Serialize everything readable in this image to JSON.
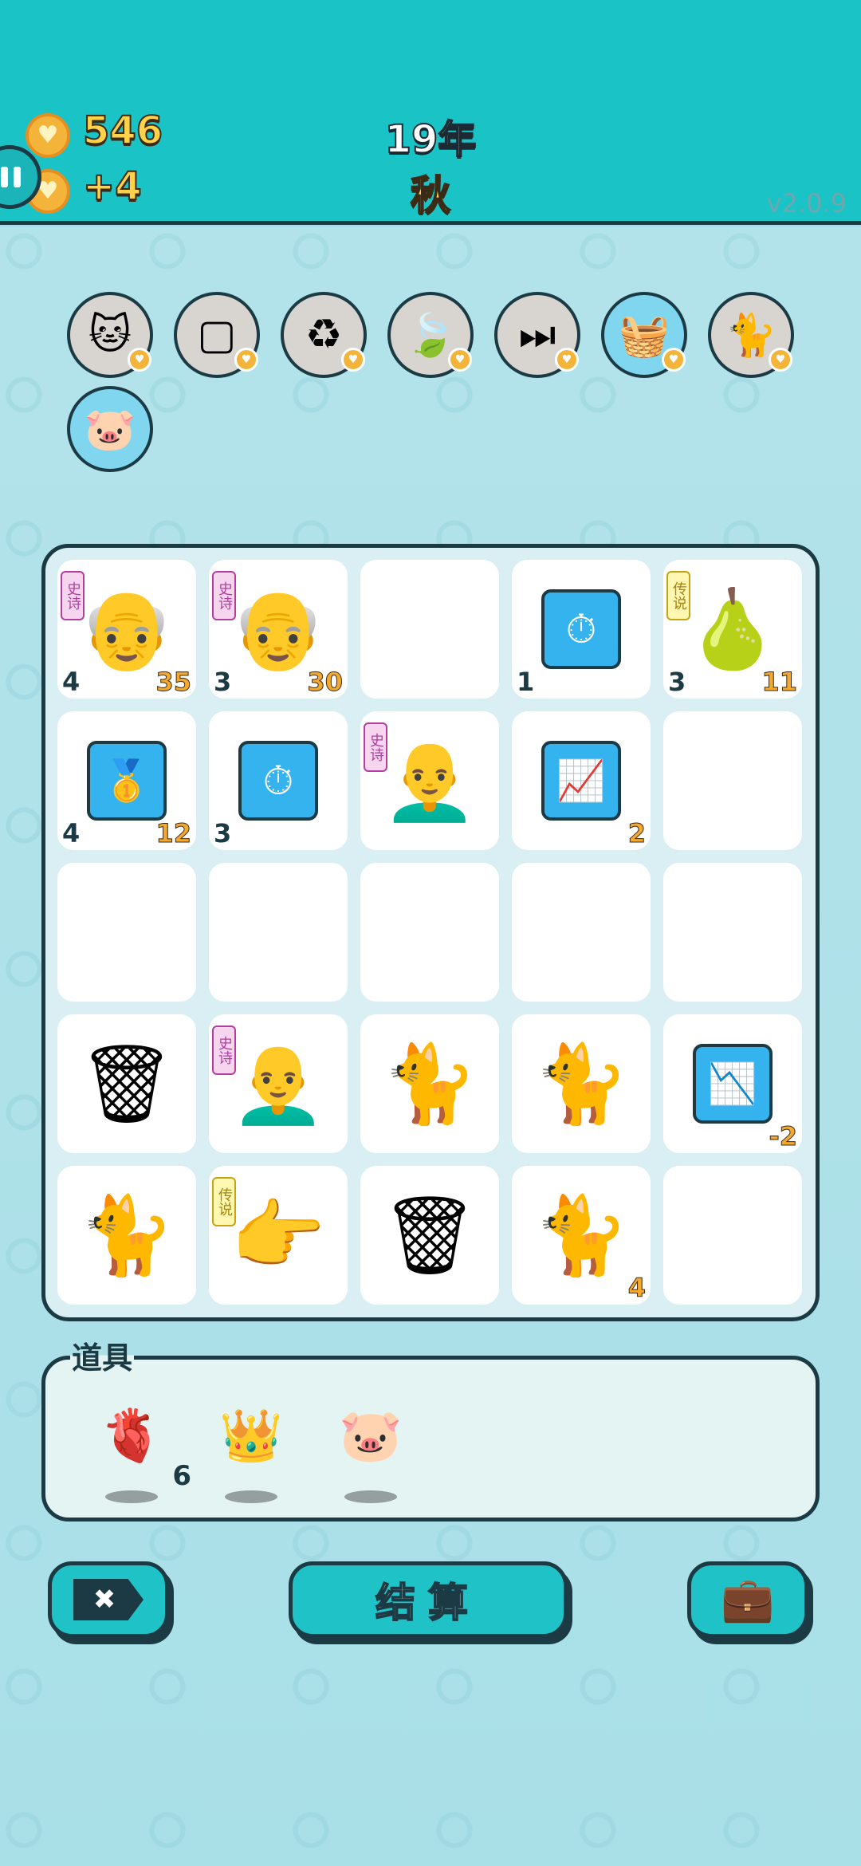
{
  "header": {
    "coins": "546",
    "income": "+4",
    "year": "19年",
    "season": "秋",
    "version": "v2.0.9"
  },
  "relics": [
    {
      "name": "twin-cats-relic-icon",
      "glyph": "🐱"
    },
    {
      "name": "blocks-relic-icon",
      "glyph": "▢"
    },
    {
      "name": "refresh-relic-icon",
      "glyph": "♻"
    },
    {
      "name": "leaf-relic-icon",
      "glyph": "🍃"
    },
    {
      "name": "skip-relic-icon",
      "glyph": "⏭"
    },
    {
      "name": "fruit-basket-relic-icon",
      "glyph": "🧺"
    },
    {
      "name": "cat-relic-icon",
      "glyph": "🐈"
    },
    {
      "name": "piggy-bank-relic-icon",
      "glyph": "🐷"
    }
  ],
  "board": {
    "cells": [
      {
        "icon": "grandpa-icon",
        "glyph": "👴",
        "tag": "史诗",
        "tag_type": "epic",
        "left": "4",
        "right": "35"
      },
      {
        "icon": "grandpa-icon",
        "glyph": "👴",
        "tag": "史诗",
        "tag_type": "epic",
        "left": "3",
        "right": "30"
      },
      {
        "icon": "empty",
        "glyph": "",
        "tag": "",
        "tag_type": "",
        "left": "",
        "right": ""
      },
      {
        "icon": "stopwatch-icon",
        "glyph": "⏱",
        "tag": "",
        "tag_type": "",
        "box": true,
        "left": "1",
        "right": ""
      },
      {
        "icon": "pear-icon",
        "glyph": "🍐",
        "tag": "传说",
        "tag_type": "leg",
        "left": "3",
        "right": "11"
      },
      {
        "icon": "gold-bars-icon",
        "glyph": "🥇",
        "tag": "",
        "tag_type": "",
        "box": true,
        "left": "4",
        "right": "12"
      },
      {
        "icon": "stopwatch-icon",
        "glyph": "⏱",
        "tag": "",
        "tag_type": "",
        "box": true,
        "left": "3",
        "right": ""
      },
      {
        "icon": "old-man-icon",
        "glyph": "👨‍🦲",
        "tag": "史诗",
        "tag_type": "epic",
        "left": "",
        "right": ""
      },
      {
        "icon": "chart-up-icon",
        "glyph": "📈",
        "tag": "",
        "tag_type": "",
        "box": true,
        "left": "",
        "right": "2"
      },
      {
        "icon": "empty",
        "glyph": "",
        "tag": "",
        "tag_type": "",
        "left": "",
        "right": ""
      },
      {
        "icon": "empty",
        "glyph": "",
        "tag": "",
        "tag_type": "",
        "left": "",
        "right": ""
      },
      {
        "icon": "empty",
        "glyph": "",
        "tag": "",
        "tag_type": "",
        "left": "",
        "right": ""
      },
      {
        "icon": "empty",
        "glyph": "",
        "tag": "",
        "tag_type": "",
        "left": "",
        "right": ""
      },
      {
        "icon": "empty",
        "glyph": "",
        "tag": "",
        "tag_type": "",
        "left": "",
        "right": ""
      },
      {
        "icon": "empty",
        "glyph": "",
        "tag": "",
        "tag_type": "",
        "left": "",
        "right": ""
      },
      {
        "icon": "trash-bag-icon",
        "glyph": "🗑",
        "tag": "",
        "tag_type": "",
        "left": "",
        "right": ""
      },
      {
        "icon": "old-man-icon",
        "glyph": "👨‍🦲",
        "tag": "史诗",
        "tag_type": "epic",
        "left": "",
        "right": ""
      },
      {
        "icon": "cat-icon",
        "glyph": "🐈",
        "tag": "",
        "tag_type": "",
        "left": "",
        "right": ""
      },
      {
        "icon": "cat-icon",
        "glyph": "🐈",
        "tag": "",
        "tag_type": "",
        "left": "",
        "right": ""
      },
      {
        "icon": "chart-down-icon",
        "glyph": "📉",
        "tag": "",
        "tag_type": "",
        "box": true,
        "left": "",
        "right": "-2"
      },
      {
        "icon": "cat-icon",
        "glyph": "🐈",
        "tag": "",
        "tag_type": "",
        "left": "",
        "right": ""
      },
      {
        "icon": "pointing-hand-icon",
        "glyph": "👉",
        "tag": "传说",
        "tag_type": "leg",
        "left": "",
        "right": ""
      },
      {
        "icon": "trash-bag-icon",
        "glyph": "🗑",
        "tag": "",
        "tag_type": "",
        "left": "",
        "right": ""
      },
      {
        "icon": "cat-icon",
        "glyph": "🐈",
        "tag": "",
        "tag_type": "",
        "left": "",
        "right": "4"
      },
      {
        "icon": "empty",
        "glyph": "",
        "tag": "",
        "tag_type": "",
        "left": "",
        "right": ""
      }
    ]
  },
  "props": {
    "title": "道具",
    "items": [
      {
        "name": "liver-icon",
        "glyph": "🫀",
        "count": "6"
      },
      {
        "name": "crown-icon",
        "glyph": "👑",
        "count": ""
      },
      {
        "name": "piggy-bank-icon",
        "glyph": "🐷",
        "count": ""
      }
    ]
  },
  "buttons": {
    "skip_glyph": "✖",
    "settle_label": "结算",
    "bag_glyph": "💼"
  },
  "colors": {
    "topbar": "#1ac3c6",
    "accent_gold": "#ffd24a",
    "outline": "#1b3a44"
  }
}
